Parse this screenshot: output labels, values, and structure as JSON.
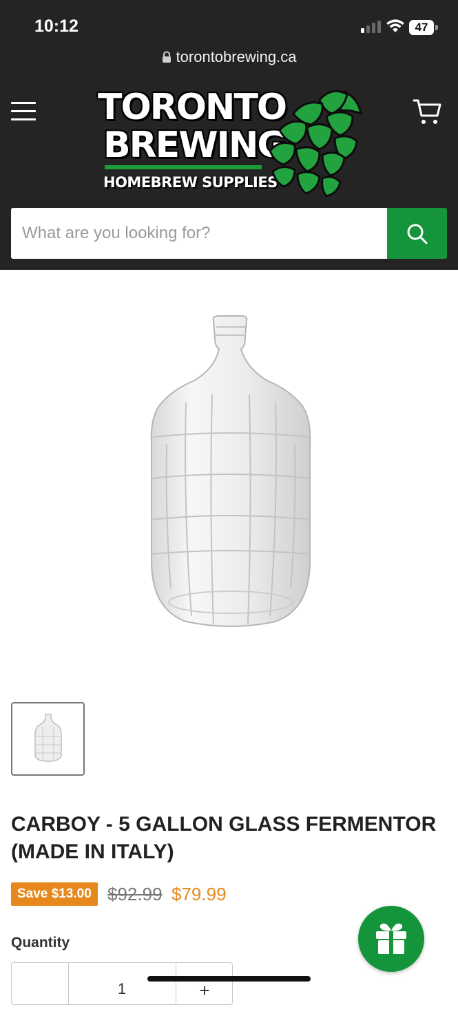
{
  "status_bar": {
    "time": "10:12",
    "battery": "47",
    "icons": [
      "cellular-signal-icon",
      "wifi-icon",
      "battery-icon"
    ]
  },
  "browser": {
    "url": "torontobrewing.ca",
    "lock_icon": "lock-icon"
  },
  "header": {
    "menu_icon": "hamburger-menu-icon",
    "cart_icon": "cart-icon",
    "logo": {
      "line1": "TORONTO",
      "line2": "BREWING",
      "line3": "HOMEBREW SUPPLIES"
    }
  },
  "search": {
    "placeholder": "What are you looking for?",
    "button_icon": "search-icon"
  },
  "product": {
    "title": "CARBOY - 5 GALLON GLASS FERMENTOR (MADE IN ITALY)",
    "save_badge": "Save $13.00",
    "compare_price": "$92.99",
    "price": "$79.99",
    "quantity_label": "Quantity",
    "quantity_value": "1",
    "quantity_increment": "+"
  },
  "colors": {
    "header_bg": "#242424",
    "brand_green": "#14953b",
    "sale_orange": "#e6881c"
  },
  "gift_button_icon": "gift-icon"
}
